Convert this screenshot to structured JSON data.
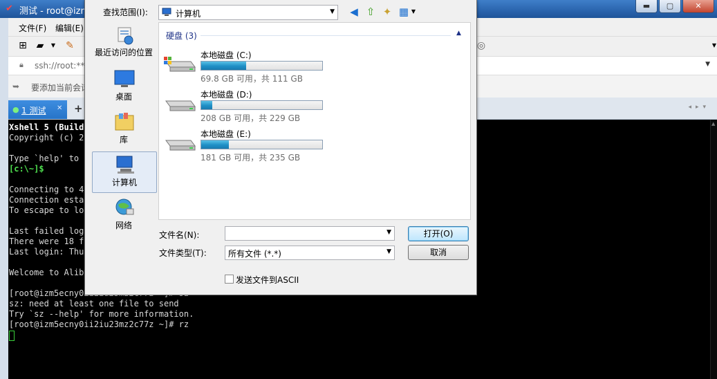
{
  "window": {
    "title": "测试 - root@izm",
    "buttons": {
      "minimize": "▬",
      "maximize": "▢",
      "close": "✕"
    }
  },
  "menu": {
    "items": [
      "文件(F)",
      "编辑(E)"
    ]
  },
  "address": {
    "value": "ssh://root:***"
  },
  "hint": {
    "text": "要添加当前会话"
  },
  "tabs": [
    {
      "label": "1 测试"
    }
  ],
  "tab_add": "+",
  "terminal": {
    "lines": [
      "Xshell 5 (Build",
      "Copyright (c) 20",
      "",
      "Type `help' to l",
      "[c:\\~]$",
      "",
      "Connecting to 47",
      "Connection estab",
      "To escape to loc",
      "",
      "Last failed logi",
      "There were 18 fa",
      "Last login: Thu ",
      "",
      "Welcome to Aliba",
      "",
      "[root@izm5ecny0ii2iu23mz2c77z ~]# sz",
      "sz: need at least one file to send",
      "Try `sz --help' for more information.",
      "[root@izm5ecny0ii2iu23mz2c77z ~]# rz"
    ]
  },
  "dialog": {
    "lookin_label": "查找范围(I):",
    "lookin_value": "计算机",
    "places": [
      {
        "label": "最近访问的位置",
        "icon": "recent-places-icon"
      },
      {
        "label": "桌面",
        "icon": "desktop-icon"
      },
      {
        "label": "库",
        "icon": "library-icon"
      },
      {
        "label": "计算机",
        "icon": "computer-icon"
      },
      {
        "label": "网络",
        "icon": "network-icon"
      }
    ],
    "group_header": "硬盘 (3)",
    "drives": [
      {
        "name": "本地磁盘 (C:)",
        "free": "69.8 GB 可用，共 111 GB",
        "used_fraction": 0.37
      },
      {
        "name": "本地磁盘 (D:)",
        "free": "208 GB 可用，共 229 GB",
        "used_fraction": 0.09
      },
      {
        "name": "本地磁盘 (E:)",
        "free": "181 GB 可用，共 235 GB",
        "used_fraction": 0.23
      }
    ],
    "filename_label": "文件名(N):",
    "filename_value": "",
    "filetype_label": "文件类型(T):",
    "filetype_value": "所有文件 (*.*)",
    "open_button": "打开(O)",
    "cancel_button": "取消",
    "ascii_label": "发送文件到ASCII"
  },
  "colors": {
    "drive_fill": "#1f8fc6",
    "title_bar": "#2a64ad",
    "terminal_bg": "#000000"
  }
}
